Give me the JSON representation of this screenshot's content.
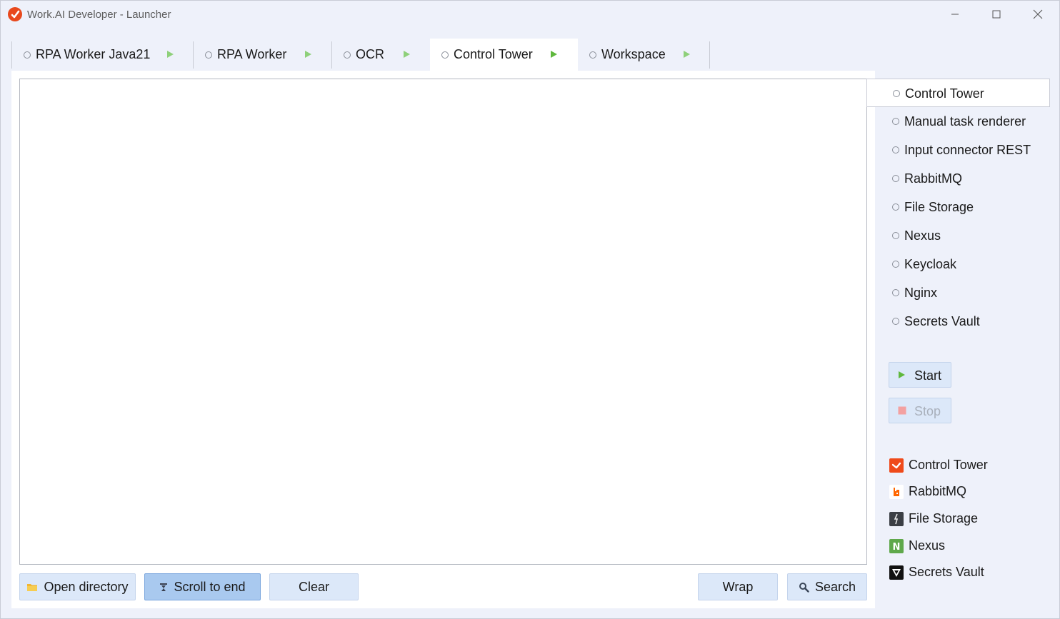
{
  "window": {
    "title": "Work.AI Developer - Launcher"
  },
  "tabs": [
    {
      "label": "RPA Worker Java21",
      "active": false
    },
    {
      "label": "RPA Worker",
      "active": false
    },
    {
      "label": "OCR",
      "active": false
    },
    {
      "label": "Control Tower",
      "active": true
    },
    {
      "label": "Workspace",
      "active": false
    }
  ],
  "sidebar": {
    "services": [
      {
        "label": "Control Tower",
        "selected": true
      },
      {
        "label": "Manual task renderer",
        "selected": false
      },
      {
        "label": "Input connector REST",
        "selected": false
      },
      {
        "label": "RabbitMQ",
        "selected": false
      },
      {
        "label": "File Storage",
        "selected": false
      },
      {
        "label": "Nexus",
        "selected": false
      },
      {
        "label": "Keycloak",
        "selected": false
      },
      {
        "label": "Nginx",
        "selected": false
      },
      {
        "label": "Secrets Vault",
        "selected": false
      }
    ],
    "start_label": "Start",
    "stop_label": "Stop",
    "links": [
      {
        "label": "Control Tower",
        "icon": "control-tower-icon"
      },
      {
        "label": "RabbitMQ",
        "icon": "rabbitmq-icon"
      },
      {
        "label": "File Storage",
        "icon": "file-storage-icon"
      },
      {
        "label": "Nexus",
        "icon": "nexus-icon"
      },
      {
        "label": "Secrets Vault",
        "icon": "vault-icon"
      }
    ]
  },
  "toolbar": {
    "open_directory": "Open directory",
    "scroll_to_end": "Scroll to end",
    "clear": "Clear",
    "wrap": "Wrap",
    "search": "Search"
  },
  "colors": {
    "accent": "#e8491d",
    "play_green": "#6cc04a",
    "stop_red": "#f08a8a",
    "button_bg": "#dce8f9",
    "button_pressed": "#a9c9ef"
  }
}
